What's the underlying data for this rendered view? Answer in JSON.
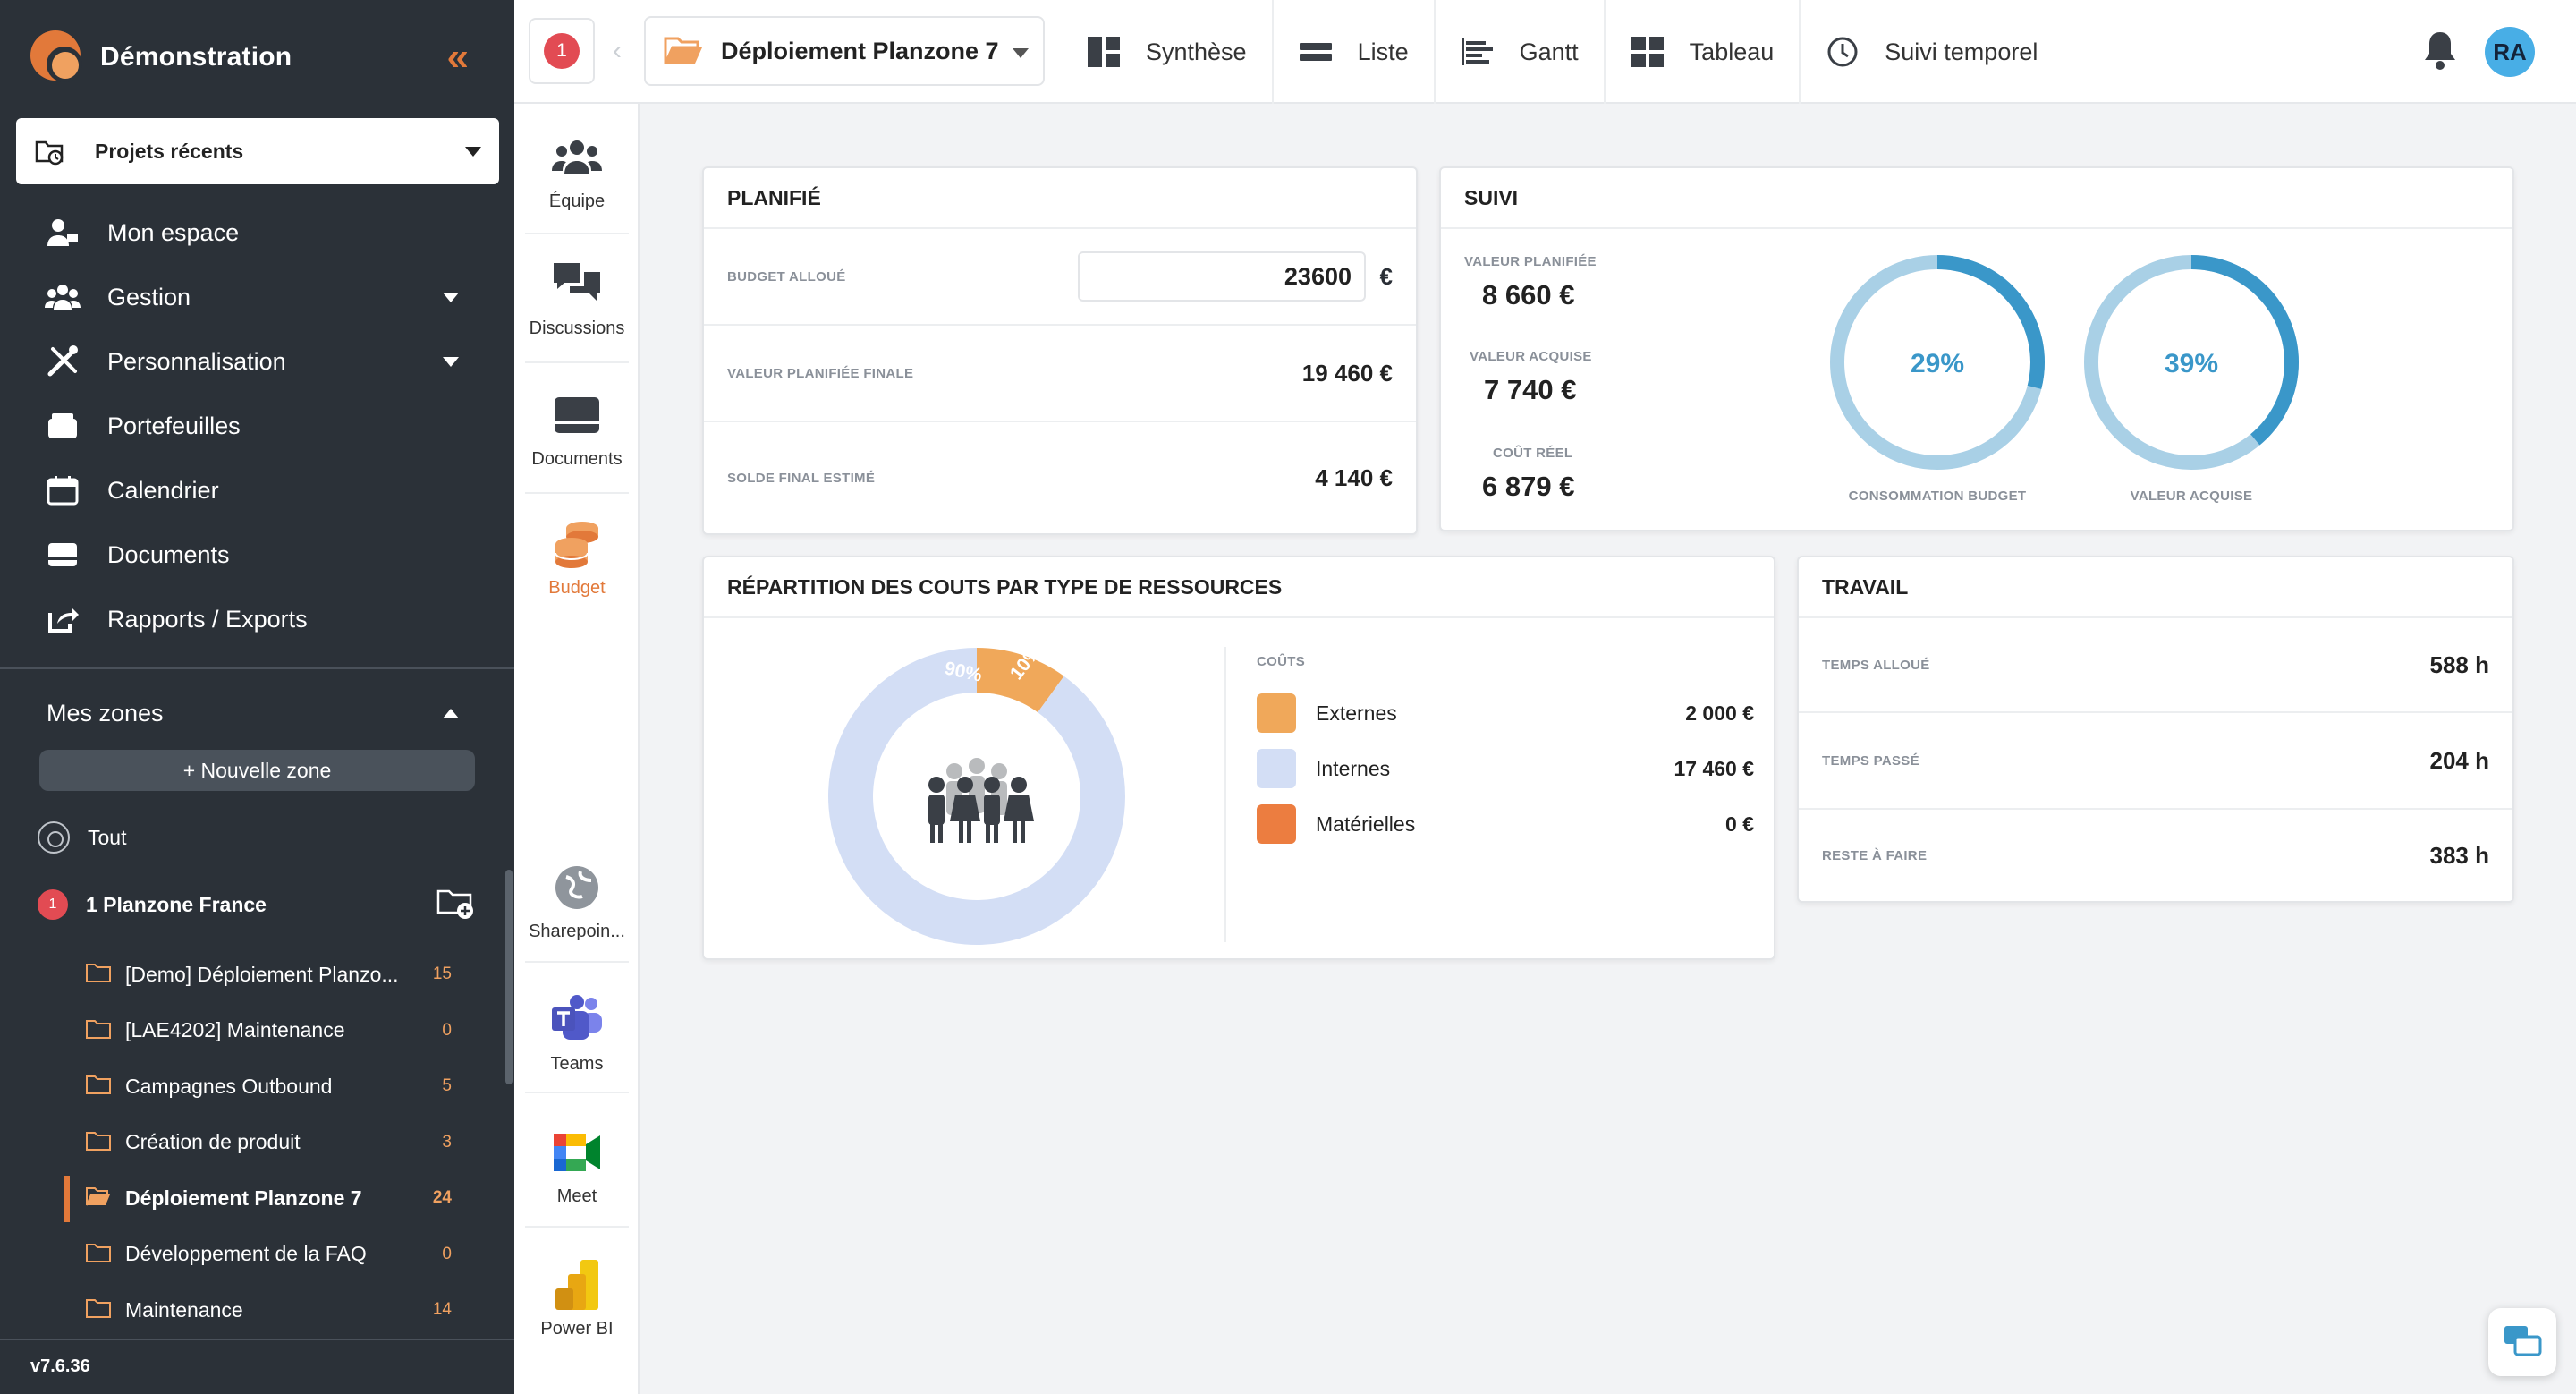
{
  "app": {
    "title": "Démonstration"
  },
  "sidebar": {
    "recent_label": "Projets récents",
    "nav": [
      {
        "label": "Mon espace",
        "icon": "user-icon"
      },
      {
        "label": "Gestion",
        "icon": "team-icon"
      },
      {
        "label": "Personnalisation",
        "icon": "tools-icon"
      },
      {
        "label": "Portefeuilles",
        "icon": "wallet-icon"
      },
      {
        "label": "Calendrier",
        "icon": "calendar-icon"
      },
      {
        "label": "Documents",
        "icon": "inbox-icon"
      },
      {
        "label": "Rapports / Exports",
        "icon": "export-icon"
      }
    ],
    "zones_title": "Mes zones",
    "new_zone_label": "+ Nouvelle zone",
    "all_label": "Tout",
    "zone": {
      "badge": "1",
      "name": "1 Planzone France"
    },
    "projects": [
      {
        "name": "[Demo] Déploiement Planzo...",
        "count": "15"
      },
      {
        "name": "[LAE4202] Maintenance",
        "count": "0"
      },
      {
        "name": "Campagnes Outbound",
        "count": "5"
      },
      {
        "name": "Création de produit",
        "count": "3"
      },
      {
        "name": "Déploiement Planzone 7",
        "count": "24",
        "active": true
      },
      {
        "name": "Développement de la FAQ",
        "count": "0"
      },
      {
        "name": "Maintenance",
        "count": "14"
      }
    ],
    "version": "v7.6.36"
  },
  "topbar": {
    "notification_count": "1",
    "project": "Déploiement Planzone 7",
    "views": [
      {
        "label": "Synthèse",
        "icon": "dashboard-icon"
      },
      {
        "label": "Liste",
        "icon": "list-icon"
      },
      {
        "label": "Gantt",
        "icon": "gantt-icon"
      },
      {
        "label": "Tableau",
        "icon": "board-icon"
      },
      {
        "label": "Suivi temporel",
        "icon": "clock-icon"
      }
    ],
    "avatar": "RA"
  },
  "tools": [
    {
      "label": "Équipe",
      "icon": "team-icon"
    },
    {
      "label": "Discussions",
      "icon": "chat-icon"
    },
    {
      "label": "Documents",
      "icon": "inbox-icon"
    },
    {
      "label": "Budget",
      "icon": "coins-icon",
      "selected": true
    },
    {
      "label": "Sharepoin...",
      "icon": "sharepoint-icon"
    },
    {
      "label": "Teams",
      "icon": "teams-icon"
    },
    {
      "label": "Meet",
      "icon": "meet-icon"
    },
    {
      "label": "Power BI",
      "icon": "powerbi-icon"
    }
  ],
  "planifie": {
    "title": "PLANIFIÉ",
    "budget_label": "BUDGET ALLOUÉ",
    "budget_value": "23600",
    "currency": "€",
    "final_label": "VALEUR PLANIFIÉE FINALE",
    "final_value": "19 460 €",
    "solde_label": "SOLDE FINAL ESTIMÉ",
    "solde_value": "4 140 €"
  },
  "suivi": {
    "title": "SUIVI",
    "planned_label": "VALEUR PLANIFIÉE",
    "planned_value": "8 660 €",
    "acquired_label": "VALEUR ACQUISE",
    "acquired_value": "7 740 €",
    "cost_label": "COÛT RÉEL",
    "cost_value": "6 879 €",
    "gauges": [
      {
        "percent": 29,
        "text": "29%",
        "label": "CONSOMMATION BUDGET"
      },
      {
        "percent": 39,
        "text": "39%",
        "label": "VALEUR ACQUISE"
      }
    ]
  },
  "repartition": {
    "title": "RÉPARTITION DES COUTS PAR TYPE DE RESSOURCES",
    "legend_title": "COÛTS",
    "items": [
      {
        "name": "Externes",
        "value": "2 000 €",
        "color": "#f0a85a",
        "share": 10
      },
      {
        "name": "Internes",
        "value": "17 460 €",
        "color": "#d3def5",
        "share": 90
      },
      {
        "name": "Matérielles",
        "value": "0 €",
        "color": "#ec7d40",
        "share": 0
      }
    ],
    "slice_labels": [
      "90%",
      "10%"
    ]
  },
  "travail": {
    "title": "TRAVAIL",
    "rows": [
      {
        "label": "TEMPS ALLOUÉ",
        "value": "588 h"
      },
      {
        "label": "TEMPS PASSÉ",
        "value": "204 h"
      },
      {
        "label": "RESTE À FAIRE",
        "value": "383 h"
      }
    ]
  },
  "colors": {
    "accent": "#e2793a",
    "sidebar": "#2b3138",
    "gauge": "#3a97c9",
    "gauge_track": "#a9d0e6"
  }
}
